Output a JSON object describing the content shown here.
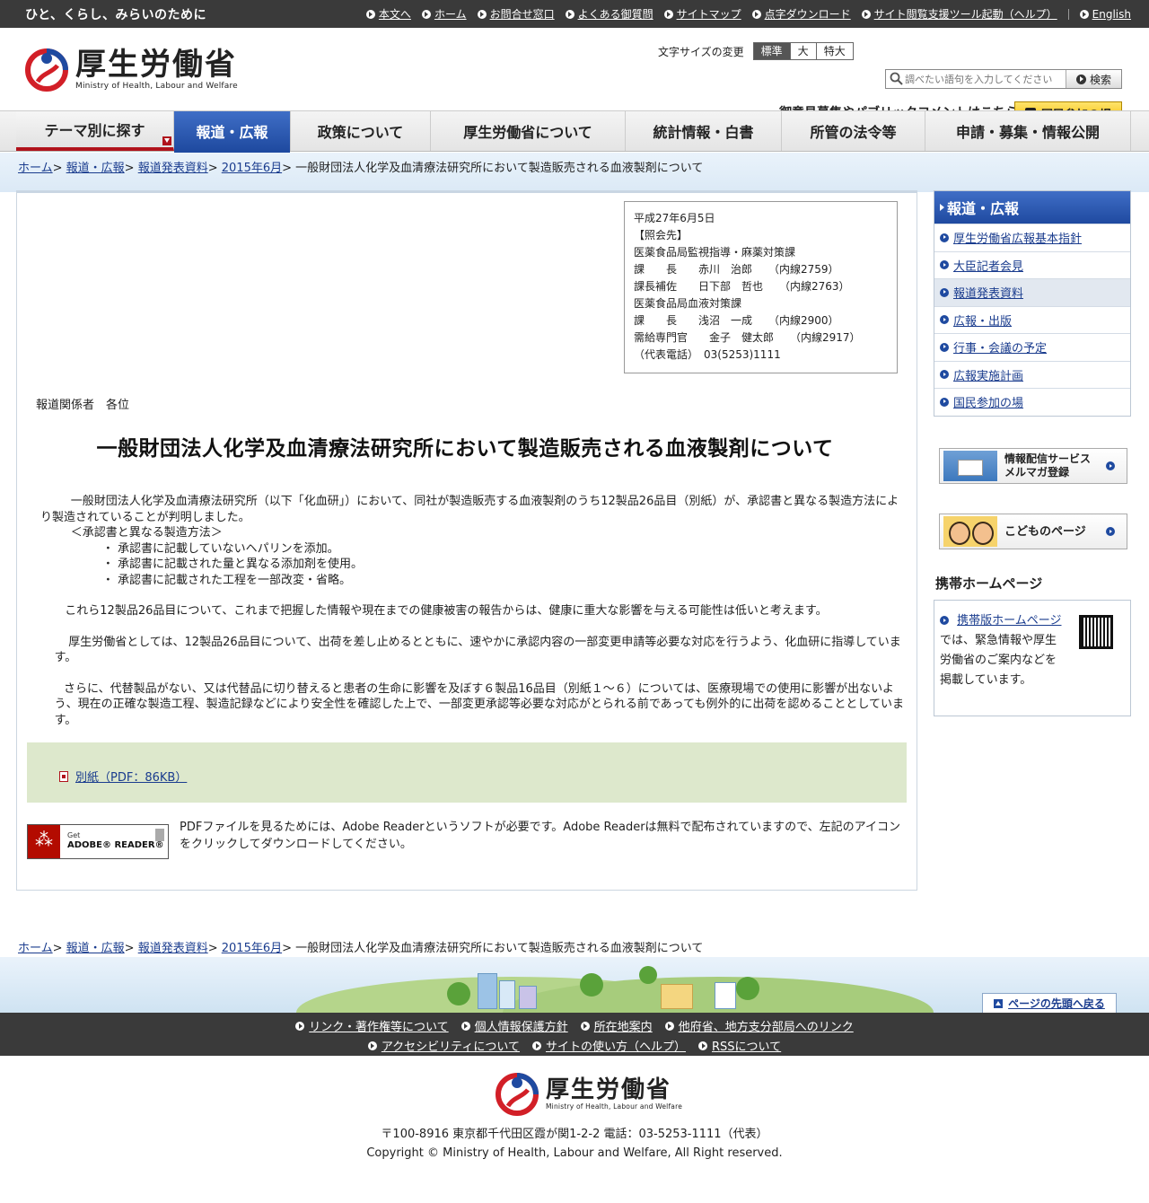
{
  "topbar": {
    "tagline": "ひと、くらし、みらいのために",
    "links": [
      "本文へ",
      "ホーム",
      "お問合せ窓口",
      "よくある御質問",
      "サイトマップ",
      "点字ダウンロード",
      "サイト閲覧支援ツール起動（ヘルプ）"
    ],
    "english": "English"
  },
  "header": {
    "logo_jp": "厚生労働省",
    "logo_en": "Ministry of Health, Labour and Welfare",
    "fontsize_label": "文字サイズの変更",
    "fontsize_options": [
      "標準",
      "大",
      "特大"
    ],
    "search_placeholder": "調べたい語句を入力してください",
    "search_button": "検索",
    "pubcomment": "御意見募集やパブリックコメントはこちら",
    "sanka_button": "国民参加の場"
  },
  "gnav": {
    "items": [
      "テーマ別に探す",
      "報道・広報",
      "政策について",
      "厚生労働省について",
      "統計情報・白書",
      "所管の法令等",
      "申請・募集・情報公開"
    ]
  },
  "breadcrumb": {
    "home": "ホーム",
    "l1": "報道・広報",
    "l2": "報道発表資料",
    "l3": "2015年6月",
    "current": "一般財団法人化学及血清療法研究所において製造販売される血液製剤について"
  },
  "contact": {
    "lines": [
      "平成27年6月5日",
      "【照会先】",
      "医薬食品局監視指導・麻薬対策課",
      "課　　長　　赤川　治郎　　（内線2759）",
      "課長補佐　　日下部　哲也　　（内線2763）",
      "医薬食品局血液対策課",
      "課　　長　　浅沼　一成　　（内線2900）",
      "需給専門官　　金子　健太郎　　（内線2917）",
      "（代表電話）　03(5253)1111"
    ]
  },
  "article": {
    "addressee": "報道関係者　各位",
    "title": "一般財団法人化学及血清療法研究所において製造販売される血液製剤について",
    "para1": "一般財団法人化学及血清療法研究所（以下「化血研」）において、同社が製造販売する血液製剤のうち12製品26品目（別紙）が、承認書と異なる製造方法により製造されていることが判明しました。",
    "method_head": "＜承認書と異なる製造方法＞",
    "methods": [
      "・ 承認書に記載していないヘパリンを添加。",
      "・ 承認書に記載された量と異なる添加剤を使用。",
      "・ 承認書に記載された工程を一部改変・省略。"
    ],
    "para2": "これら12製品26品目について、これまで把握した情報や現在までの健康被害の報告からは、健康に重大な影響を与える可能性は低いと考えます。",
    "para3": "厚生労働省としては、12製品26品目について、出荷を差し止めるとともに、速やかに承認内容の一部変更申請等必要な対応を行うよう、化血研に指導しています。",
    "para4": "さらに、代替製品がない、又は代替品に切り替えると患者の生命に影響を及ぼす６製品16品目（別紙１～６）については、医療現場での使用に影響が出ないよう、現在の正確な製造工程、製造記録などにより安全性を確認した上で、一部変更承認等必要な対応がとられる前であっても例外的に出荷を認めることとしています。",
    "attachment": "別紙（PDF：86KB）",
    "adobe_get": "Get",
    "adobe_reader": "ADOBE® READER®",
    "adobe_note": "PDFファイルを見るためには、Adobe Readerというソフトが必要です。Adobe Readerは無料で配布されていますので、左記のアイコンをクリックしてダウンロードしてください。"
  },
  "sidebar": {
    "heading": "報道・広報",
    "items": [
      "厚生労働省広報基本指針",
      "大臣記者会見",
      "報道発表資料",
      "広報・出版",
      "行事・会議の予定",
      "広報実施計画",
      "国民参加の場"
    ],
    "mail_banner": [
      "情報配信サービス",
      "メルマガ登録"
    ],
    "kids_banner": "こどものページ",
    "mobile_title": "携帯ホームページ",
    "mobile_link": "携帯版ホームページ",
    "mobile_text": "では、緊急情報や厚生労働省のご案内などを掲載しています。"
  },
  "footer": {
    "pagetop": "ページの先頭へ戻る",
    "row1": [
      "リンク・著作権等について",
      "個人情報保護方針",
      "所在地案内",
      "他府省、地方支分部局へのリンク"
    ],
    "row2": [
      "アクセシビリティについて",
      "サイトの使い方（ヘルプ）",
      "RSSについて"
    ],
    "address": "〒100-8916 東京都千代田区霞が関1-2-2 電話：03-5253-1111（代表）",
    "copyright": "Copyright © Ministry of Health, Labour and Welfare, All Right reserved."
  },
  "colors": {
    "brand_blue": "#1f4aa0",
    "brand_red": "#b0121b",
    "attachment_bg": "#dde8cc",
    "dark_bar": "#3a3a3a"
  }
}
